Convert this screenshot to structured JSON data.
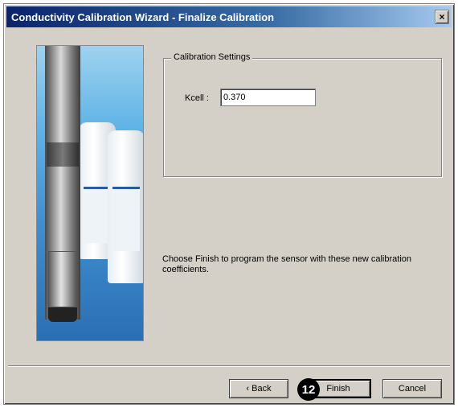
{
  "window": {
    "title": "Conductivity Calibration Wizard - Finalize Calibration",
    "close_label": "×"
  },
  "calibration_settings": {
    "group_label": "Calibration Settings",
    "kcell_label": "Kcell :",
    "kcell_value": "0.370"
  },
  "instructions": "Choose Finish to program the sensor with these new calibration coefficients.",
  "buttons": {
    "back": "‹ Back",
    "finish": "Finish",
    "cancel": "Cancel"
  },
  "callout_number": "12",
  "colors": {
    "title_bar": "#0a246a",
    "dialog_bg": "#d4d0c8"
  }
}
